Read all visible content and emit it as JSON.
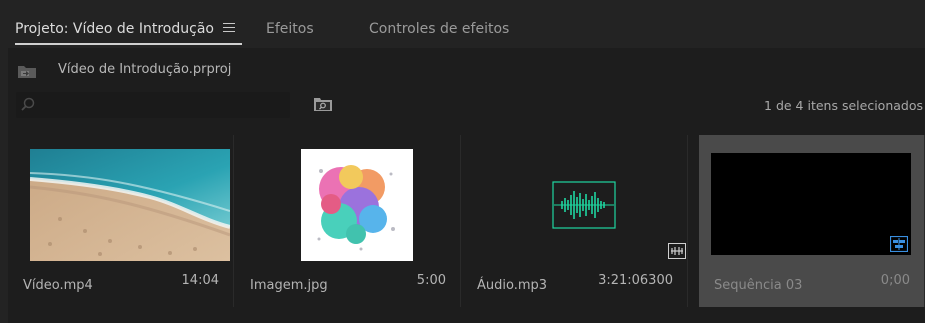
{
  "tabs": [
    {
      "label": "Projeto: Vídeo de Introdução",
      "active": true
    },
    {
      "label": "Efeitos",
      "active": false
    },
    {
      "label": "Controles de efeitos",
      "active": false
    }
  ],
  "project": {
    "file_name": "Vídeo de Introdução.prproj"
  },
  "search": {
    "placeholder": ""
  },
  "status": {
    "selection_text": "1 de 4 itens selecionados"
  },
  "items": [
    {
      "name": "Vídeo.mp4",
      "duration": "14:04",
      "type": "video",
      "selected": false
    },
    {
      "name": "Imagem.jpg",
      "duration": "5:00",
      "type": "image",
      "selected": false
    },
    {
      "name": "Áudio.mp3",
      "duration": "3:21:06300",
      "type": "audio",
      "selected": false
    },
    {
      "name": "Sequência 03",
      "duration": "0;00",
      "type": "sequence",
      "selected": true
    }
  ],
  "colors": {
    "panel_bg": "#1d1d1d",
    "tab_bg": "#232323",
    "selected_tile": "#4a4a4a",
    "audio_waveform": "#1fd6a0",
    "sequence_badge": "#3a8fe0"
  },
  "icons": {
    "menu": "hamburger-icon",
    "folder": "project-folder-icon",
    "search": "search-icon",
    "new_bin": "new-bin-icon",
    "audio_badge": "audio-clip-badge-icon",
    "sequence_badge": "sequence-badge-icon"
  }
}
